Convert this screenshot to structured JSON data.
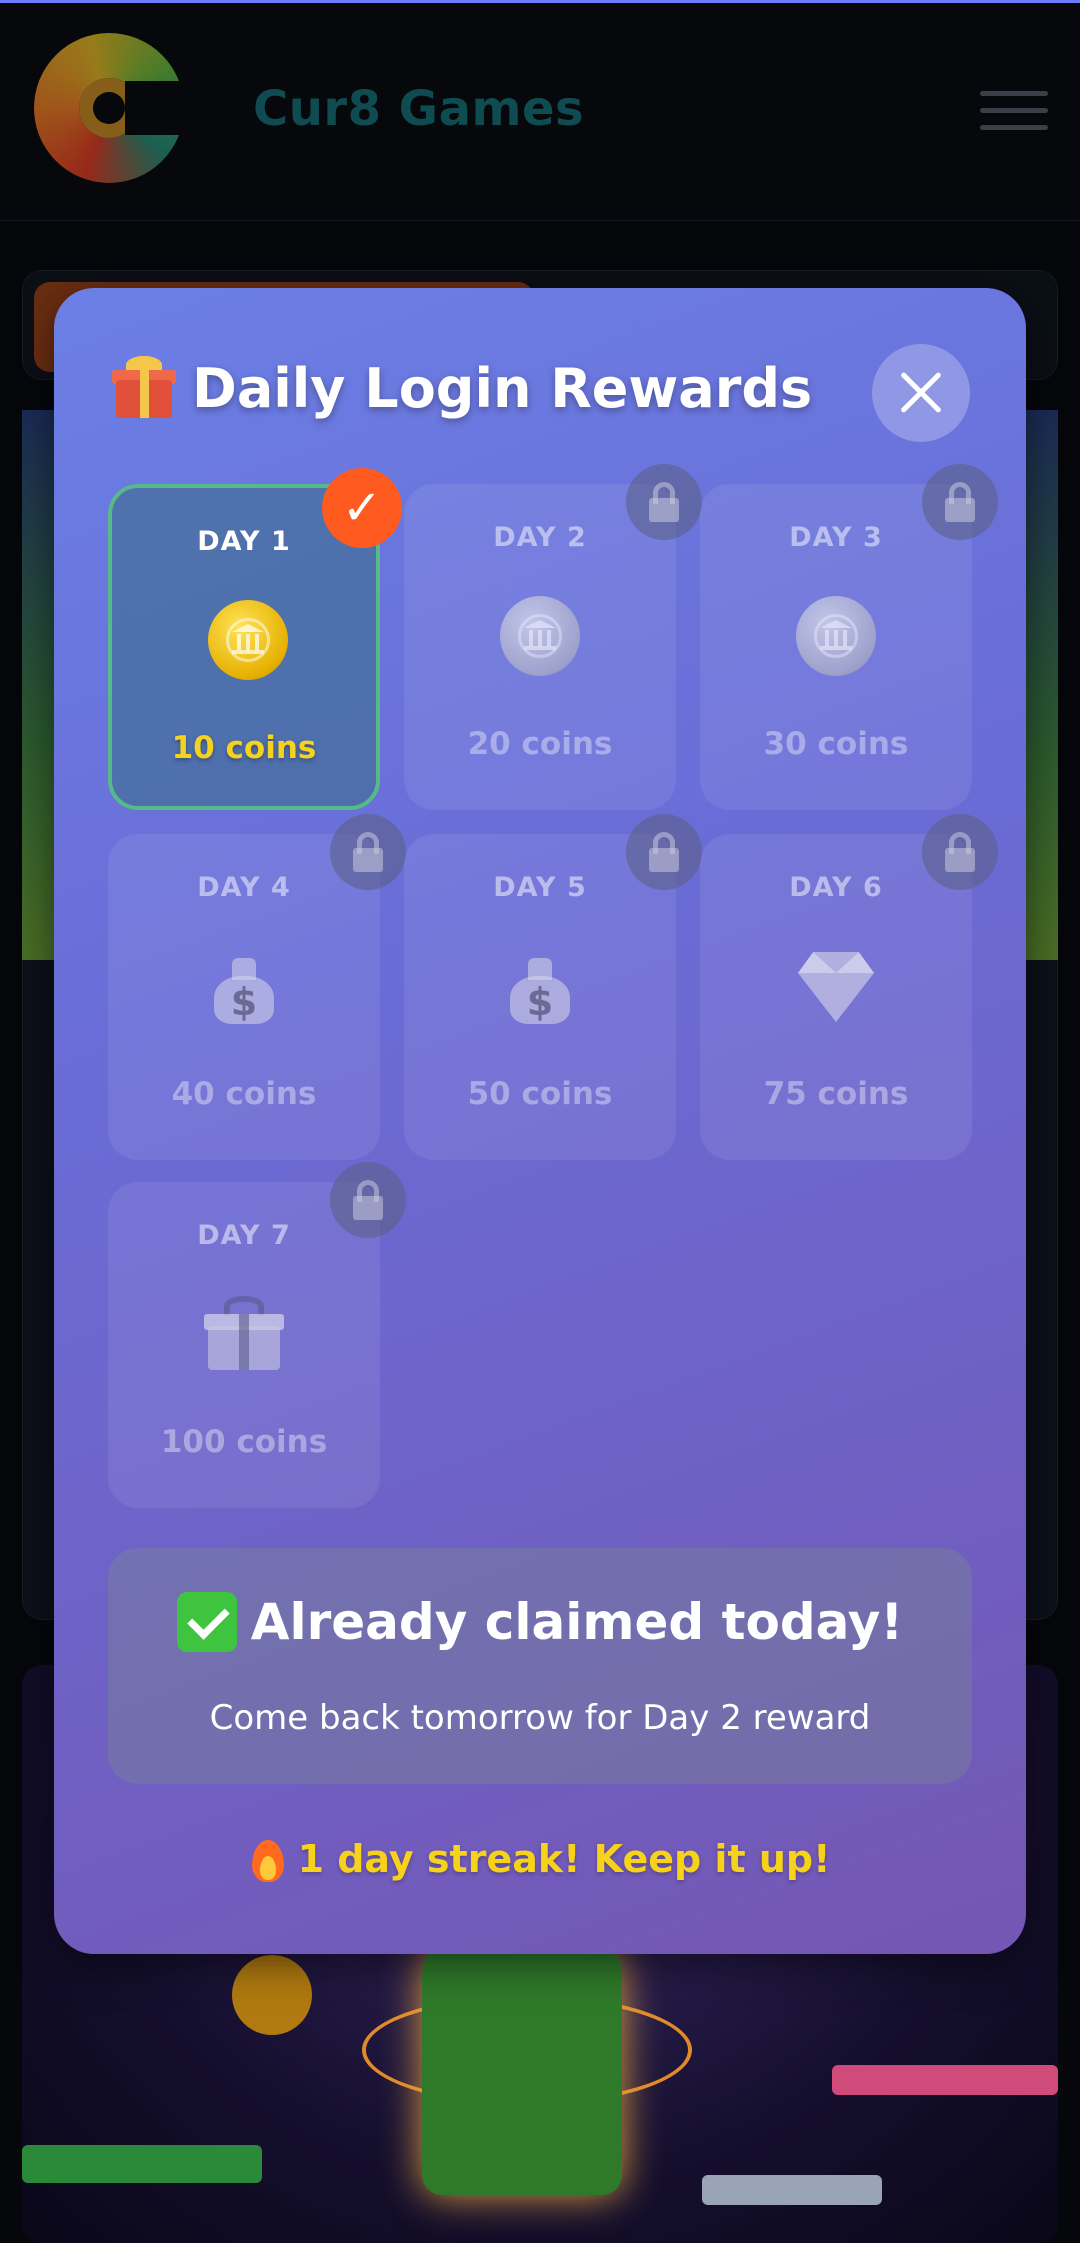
{
  "app": {
    "brand": "Cur8 Games"
  },
  "modal": {
    "title": "Daily Login Rewards",
    "title_icon": "gift-icon",
    "close_icon": "close-icon",
    "days": [
      {
        "label": "DAY 1",
        "amount": "10 coins",
        "icon": "gold-coin-icon",
        "status": "claimed"
      },
      {
        "label": "DAY 2",
        "amount": "20 coins",
        "icon": "silver-coin-icon",
        "status": "locked"
      },
      {
        "label": "DAY 3",
        "amount": "30 coins",
        "icon": "silver-coin-icon",
        "status": "locked"
      },
      {
        "label": "DAY 4",
        "amount": "40 coins",
        "icon": "money-bag-icon",
        "status": "locked"
      },
      {
        "label": "DAY 5",
        "amount": "50 coins",
        "icon": "money-bag-icon",
        "status": "locked"
      },
      {
        "label": "DAY 6",
        "amount": "75 coins",
        "icon": "diamond-icon",
        "status": "locked"
      },
      {
        "label": "DAY 7",
        "amount": "100 coins",
        "icon": "gift-icon",
        "status": "locked"
      }
    ],
    "claimed_badge": "✓",
    "status": {
      "title": "Already claimed today!",
      "subtitle": "Come back tomorrow for Day 2 reward"
    },
    "streak": "1 day streak! Keep it up!"
  },
  "colors": {
    "accent_yellow": "#f6d21a",
    "claimed_border": "#56b98a",
    "check_badge": "#ff5a1f"
  }
}
